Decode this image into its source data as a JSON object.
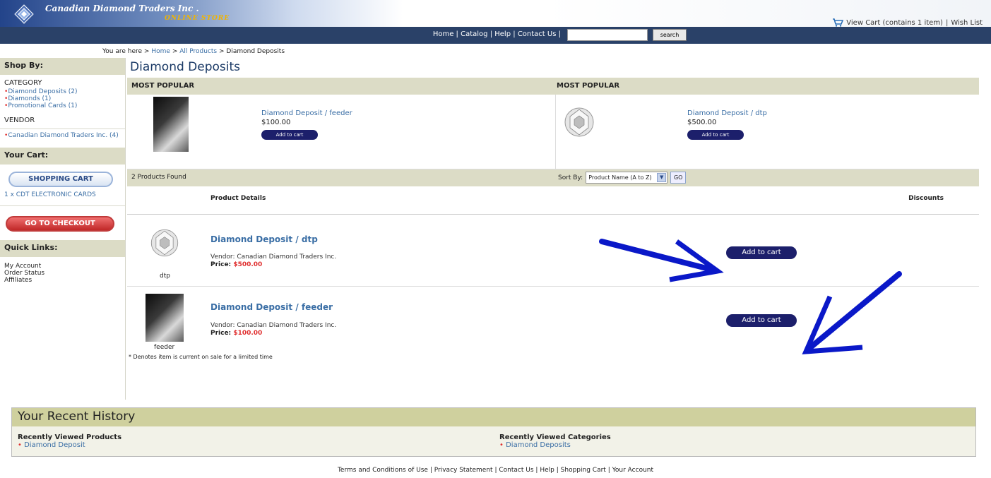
{
  "header": {
    "title": "Canadian Diamond Traders Inc .",
    "subtitle": "ONLINE STORE",
    "cart_text": "View Cart (contains 1 item)",
    "separator": "|",
    "wish_list": "Wish List"
  },
  "nav": {
    "links": [
      "Home",
      "Catalog",
      "Help",
      "Contact Us"
    ],
    "separator": "|",
    "search_value": "",
    "search_button": "search"
  },
  "breadcrumb": {
    "prefix": "You are here >",
    "items": [
      "Home",
      "All Products"
    ],
    "separator": ">",
    "current": "Diamond Deposits"
  },
  "sidebar": {
    "shop_by_title": "Shop By:",
    "category_label": "CATEGORY",
    "categories": [
      {
        "bullet": "•",
        "label": "Diamond Deposits (2)"
      },
      {
        "bullet": "•",
        "label": "Diamonds (1)"
      },
      {
        "bullet": "•",
        "label": "Promotional Cards (1)"
      }
    ],
    "vendor_label": "VENDOR",
    "vendors": [
      {
        "bullet": "•",
        "label": "Canadian Diamond Traders Inc. (4)"
      }
    ],
    "cart_title": "Your Cart:",
    "shopping_cart_button": "SHOPPING CART",
    "cart_item": "1 x CDT ELECTRONIC CARDS",
    "checkout_button": "GO TO CHECKOUT",
    "quick_links_title": "Quick Links:",
    "quick_links": [
      "My Account",
      "Order Status",
      "Affiliates"
    ]
  },
  "main": {
    "title": "Diamond Deposits",
    "popular": [
      {
        "heading": "MOST POPULAR",
        "name": "Diamond Deposit / feeder",
        "price": "$100.00",
        "button": "Add to cart"
      },
      {
        "heading": "MOST POPULAR",
        "name": "Diamond Deposit / dtp",
        "price": "$500.00",
        "button": "Add to cart"
      }
    ],
    "results_count": "2 Products Found",
    "sort_label": "Sort By:",
    "sort_value": "Product Name (A to Z)",
    "sort_arrow": "▼",
    "go_button": "GO",
    "columns": {
      "details": "Product Details",
      "discounts": "Discounts"
    },
    "products": [
      {
        "name": "Diamond Deposit / dtp",
        "vendor": "Vendor: Canadian Diamond Traders Inc.",
        "price_label": "Price:",
        "price": "$500.00",
        "caption": "dtp",
        "button": "Add to cart"
      },
      {
        "name": "Diamond Deposit / feeder",
        "vendor": "Vendor: Canadian Diamond Traders Inc.",
        "price_label": "Price:",
        "price": "$100.00",
        "caption": "feeder",
        "button": "Add to cart"
      }
    ],
    "note": "* Denotes item is current on sale for a limited time"
  },
  "history": {
    "title": "Your Recent History",
    "products_title": "Recently Viewed Products",
    "products": [
      {
        "bullet": "•",
        "label": "Diamond Deposit"
      }
    ],
    "categories_title": "Recently Viewed Categories",
    "categories": [
      {
        "bullet": "•",
        "label": "Diamond Deposits"
      }
    ]
  },
  "footer": {
    "links": [
      "Terms and Conditions of Use",
      "Privacy Statement",
      "Contact Us",
      "Help",
      "Shopping Cart",
      "Your Account"
    ],
    "separator": "|"
  },
  "colors": {
    "nav_bg": "#2a4168",
    "accent_link": "#3a6ea5",
    "button_dark": "#1c1f6b",
    "section_bar": "#dcdcc6",
    "price_red": "#e03030",
    "annotation_arrow": "#0a18c8"
  }
}
